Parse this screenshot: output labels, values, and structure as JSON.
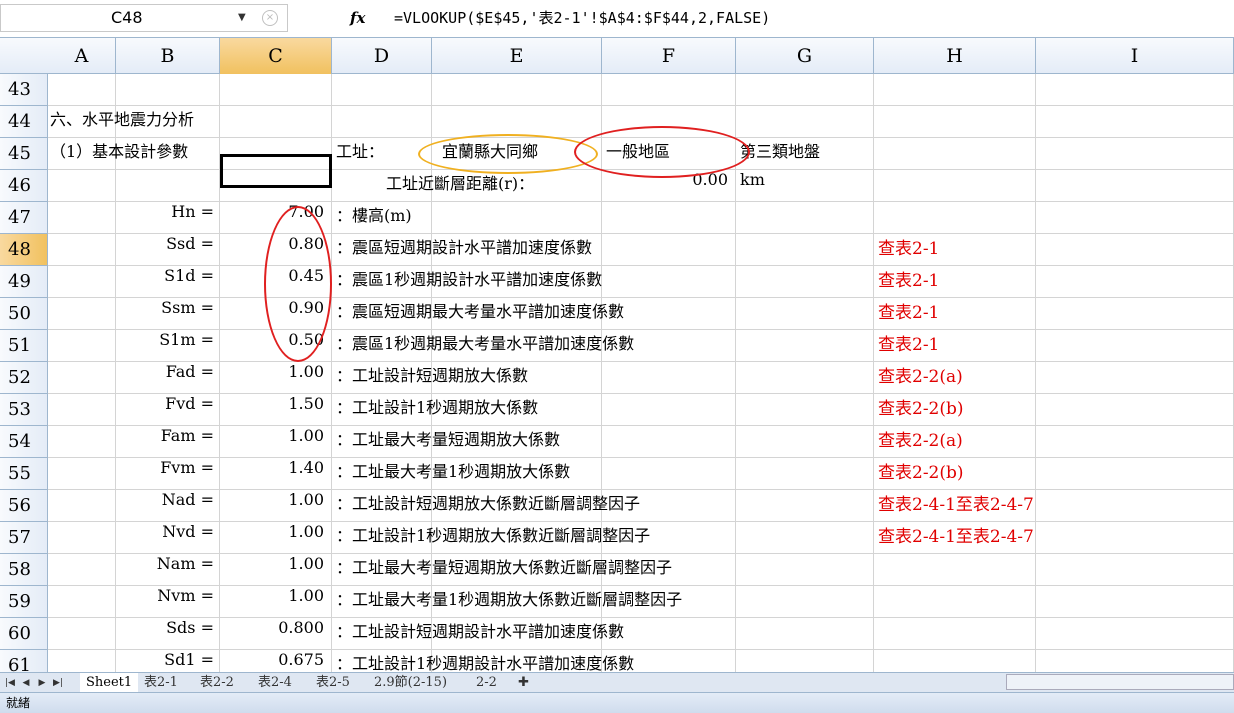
{
  "formula_bar": {
    "name_box": "C48",
    "fx_label": "fx",
    "formula": "=VLOOKUP($E$45,'表2-1'!$A$4:$F$44,2,FALSE)"
  },
  "columns": [
    "A",
    "B",
    "C",
    "D",
    "E",
    "F",
    "G",
    "H",
    "I"
  ],
  "active_column": "C",
  "active_row": "48",
  "rows": [
    {
      "n": "43"
    },
    {
      "n": "44",
      "a": "六、水平地震力分析"
    },
    {
      "n": "45",
      "a": "（1）基本設計參數",
      "d": "工址：",
      "e": "宜蘭縣大同鄉",
      "f": "一般地區",
      "g": "第三類地盤"
    },
    {
      "n": "46",
      "e_label": "工址近斷層距離(r)：",
      "f": "0.00",
      "g": "km"
    },
    {
      "n": "47",
      "b": "Hn =",
      "c": "7.00",
      "d": "：樓高(m)"
    },
    {
      "n": "48",
      "b": "Ssd =",
      "c": "0.80",
      "d": "：震區短週期設計水平譜加速度係數",
      "h": "查表2-1"
    },
    {
      "n": "49",
      "b": "S1d =",
      "c": "0.45",
      "d": "：震區1秒週期設計水平譜加速度係數",
      "h": "查表2-1"
    },
    {
      "n": "50",
      "b": "Ssm =",
      "c": "0.90",
      "d": "：震區短週期最大考量水平譜加速度係數",
      "h": "查表2-1"
    },
    {
      "n": "51",
      "b": "S1m =",
      "c": "0.50",
      "d": "：震區1秒週期最大考量水平譜加速度係數",
      "h": "查表2-1"
    },
    {
      "n": "52",
      "b": "Fad =",
      "c": "1.00",
      "d": "：工址設計短週期放大係數",
      "h": "查表2-2(a)"
    },
    {
      "n": "53",
      "b": "Fvd =",
      "c": "1.50",
      "d": "：工址設計1秒週期放大係數",
      "h": "查表2-2(b)"
    },
    {
      "n": "54",
      "b": "Fam =",
      "c": "1.00",
      "d": "：工址最大考量短週期放大係數",
      "h": "查表2-2(a)"
    },
    {
      "n": "55",
      "b": "Fvm =",
      "c": "1.40",
      "d": "：工址最大考量1秒週期放大係數",
      "h": "查表2-2(b)"
    },
    {
      "n": "56",
      "b": "Nad =",
      "c": "1.00",
      "d": "：工址設計短週期放大係數近斷層調整因子",
      "h": "查表2-4-1至表2-4-7"
    },
    {
      "n": "57",
      "b": "Nvd =",
      "c": "1.00",
      "d": "：工址設計1秒週期放大係數近斷層調整因子",
      "h": "查表2-4-1至表2-4-7"
    },
    {
      "n": "58",
      "b": "Nam =",
      "c": "1.00",
      "d": "：工址最大考量短週期放大係數近斷層調整因子"
    },
    {
      "n": "59",
      "b": "Nvm =",
      "c": "1.00",
      "d": "：工址最大考量1秒週期放大係數近斷層調整因子"
    },
    {
      "n": "60",
      "b": "Sds =",
      "c": "0.800",
      "d": "：工址設計短週期設計水平譜加速度係數"
    },
    {
      "n": "61",
      "b": "Sd1 =",
      "c": "0.675",
      "d": "：工址設計1秒週期設計水平譜加速度係數"
    }
  ],
  "sheet_tabs": [
    "Sheet1",
    "表2-1",
    "表2-2",
    "表2-4",
    "表2-5",
    "2.9節(2-15)",
    "2-2"
  ],
  "active_tab": "Sheet1",
  "status": "就緒",
  "colors": {
    "header_bg": "#e4ecf7",
    "active_header": "#f1c15f",
    "red_text": "#e00000",
    "ellipse_red": "#e02020",
    "ellipse_orange": "#f0b020"
  }
}
